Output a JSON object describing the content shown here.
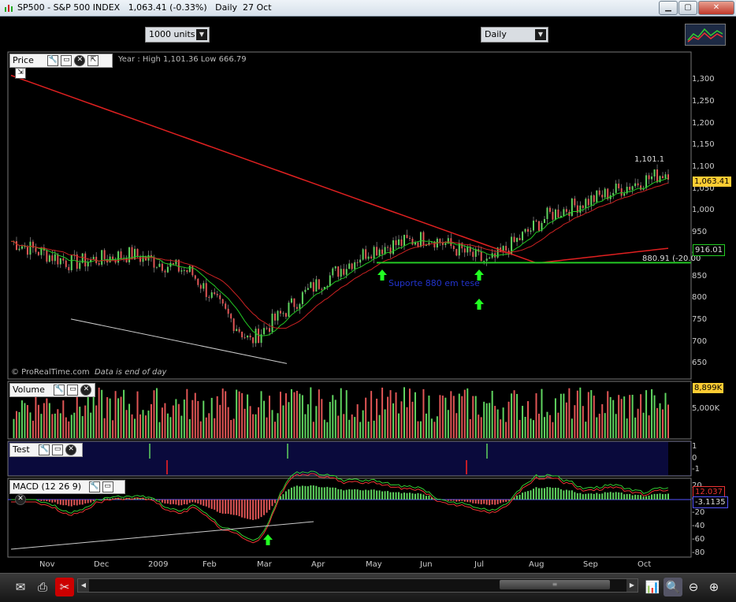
{
  "window": {
    "title": "SP500 - S&P 500 INDEX",
    "price": "1,063.41 (-0.33%)",
    "period": "Daily",
    "date": "27 Oct"
  },
  "toolbar": {
    "units": "1000 units",
    "timeframe": "Daily"
  },
  "price_panel": {
    "label": "Price",
    "year_info": "Year : High 1,101.36 Low 666.79",
    "y_ticks": [
      "1,300",
      "1,250",
      "1,200",
      "1,150",
      "1,100",
      "1,050",
      "1,000",
      "950",
      "900",
      "850",
      "800",
      "750",
      "700",
      "650"
    ],
    "last_price": "1,063.41",
    "ma_tag": "916.01",
    "support_label": "880.91 (-20.00",
    "high_label": "1,101.1",
    "annotation": "Suporte 880 em tese",
    "copyright": "© ProRealTime.com",
    "data_note": "Data is end of day"
  },
  "volume_panel": {
    "label": "Volume",
    "last": "8,899K",
    "y_tick": "5,000K"
  },
  "test_panel": {
    "label": "Test",
    "ticks": [
      "1",
      "0",
      "-1"
    ]
  },
  "macd_panel": {
    "label": "MACD (12 26 9)",
    "y_ticks": [
      "20",
      "0",
      "-20",
      "-40",
      "-60",
      "-80"
    ],
    "tag1": "12.037",
    "tag2": "-3.1135"
  },
  "x_axis": {
    "months": [
      "Nov",
      "Dec",
      "2009",
      "Feb",
      "Mar",
      "Apr",
      "May",
      "Jun",
      "Jul",
      "Aug",
      "Sep",
      "Oct"
    ]
  },
  "colors": {
    "up": "#5fd35f",
    "down": "#e05555",
    "ma_long": "#e02020",
    "ma_short": "#23c823",
    "bg": "#000000",
    "test_bg": "#0a0a3c"
  },
  "chart_data": {
    "type": "line",
    "title": "SP500 - S&P 500 INDEX",
    "series": [
      {
        "name": "Price",
        "x": [
          "Nov",
          "Dec",
          "2009",
          "Feb",
          "Mar",
          "Apr",
          "May",
          "Jun",
          "Jul",
          "Aug",
          "Sep",
          "Oct"
        ],
        "values": [
          930,
          880,
          900,
          860,
          700,
          820,
          910,
          940,
          880,
          990,
          1040,
          1090
        ]
      }
    ],
    "ylim": [
      620,
      1340
    ],
    "annotations": [
      "Suporte 880 em tese",
      "880.91 (-20.00"
    ]
  }
}
